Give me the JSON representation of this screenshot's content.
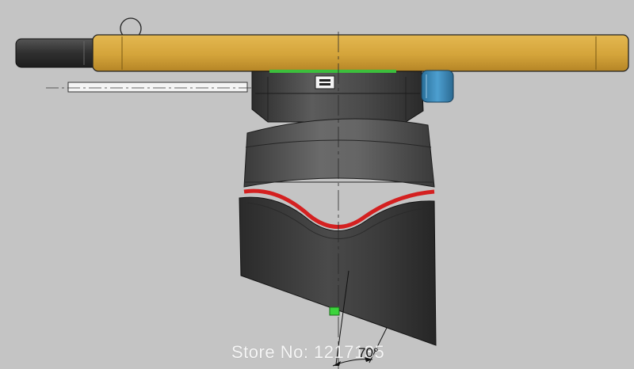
{
  "watermark": {
    "text": "Store No: 1217135"
  },
  "dimension": {
    "angle_label": "70°"
  },
  "colors": {
    "background": "#c4c4c4",
    "top_bar": "#d4a43a",
    "handle": "#3a3a3a",
    "blue_knob": "#3f8fc0",
    "red_seam": "#d42020",
    "green_marker": "#3cd43c",
    "body_dark": "#383838",
    "body_mid": "#5a5a5a"
  },
  "icons": {
    "ring": "ring-icon",
    "marker": "green-marker-icon"
  }
}
